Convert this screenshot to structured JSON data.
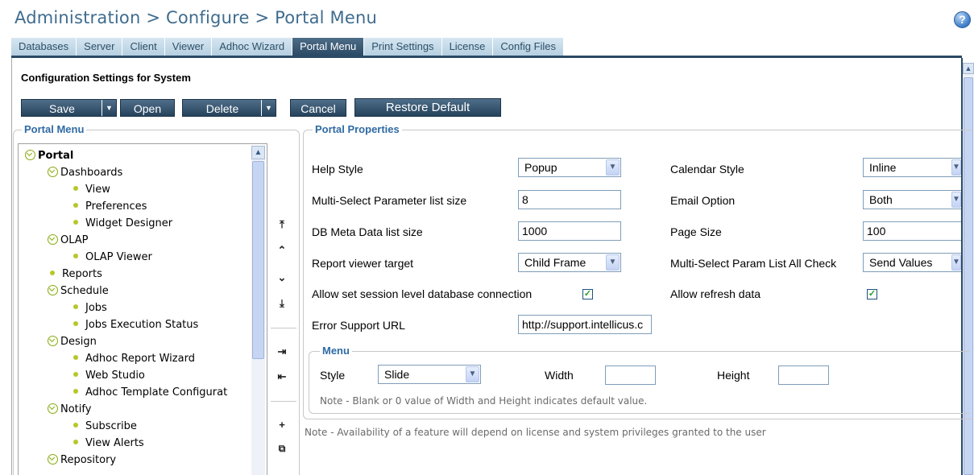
{
  "header": {
    "title": "Administration > Configure > Portal Menu",
    "help": "?"
  },
  "tabs": [
    {
      "label": "Databases"
    },
    {
      "label": "Server"
    },
    {
      "label": "Client"
    },
    {
      "label": "Viewer"
    },
    {
      "label": "Adhoc Wizard"
    },
    {
      "label": "Portal Menu",
      "active": true
    },
    {
      "label": "Print Settings"
    },
    {
      "label": "License"
    },
    {
      "label": "Config Files"
    }
  ],
  "config_heading": "Configuration Settings for System",
  "toolbar": {
    "save": "Save",
    "open": "Open",
    "delete": "Delete",
    "cancel": "Cancel",
    "restore": "Restore Default"
  },
  "portal_menu": {
    "legend": "Portal Menu",
    "items": [
      {
        "label": "Portal",
        "level": 0,
        "kind": "folder"
      },
      {
        "label": "Dashboards",
        "level": 1,
        "kind": "folder"
      },
      {
        "label": "View",
        "level": 2,
        "kind": "leaf"
      },
      {
        "label": "Preferences",
        "level": 2,
        "kind": "leaf"
      },
      {
        "label": "Widget Designer",
        "level": 2,
        "kind": "leaf"
      },
      {
        "label": "OLAP",
        "level": 1,
        "kind": "folder"
      },
      {
        "label": "OLAP Viewer",
        "level": 2,
        "kind": "leaf"
      },
      {
        "label": "Reports",
        "level": 1,
        "kind": "leaf"
      },
      {
        "label": "Schedule",
        "level": 1,
        "kind": "folder"
      },
      {
        "label": "Jobs",
        "level": 2,
        "kind": "leaf"
      },
      {
        "label": "Jobs Execution Status",
        "level": 2,
        "kind": "leaf"
      },
      {
        "label": "Design",
        "level": 1,
        "kind": "folder"
      },
      {
        "label": "Adhoc Report Wizard",
        "level": 2,
        "kind": "leaf"
      },
      {
        "label": "Web Studio",
        "level": 2,
        "kind": "leaf"
      },
      {
        "label": "Adhoc Template Configurat",
        "level": 2,
        "kind": "leaf"
      },
      {
        "label": "Notify",
        "level": 1,
        "kind": "folder"
      },
      {
        "label": "Subscribe",
        "level": 2,
        "kind": "leaf"
      },
      {
        "label": "View Alerts",
        "level": 2,
        "kind": "leaf"
      },
      {
        "label": "Repository",
        "level": 1,
        "kind": "folder"
      }
    ]
  },
  "move_buttons": {
    "top": "⤒",
    "up": "⌃",
    "down": "⌄",
    "bottom": "⤓",
    "indent": "⇥",
    "outdent": "⇤",
    "add": "+",
    "copy": "⧉"
  },
  "properties": {
    "legend": "Portal Properties",
    "help_style_label": "Help Style",
    "help_style_value": "Popup",
    "multi_select_label": "Multi-Select Parameter list size",
    "multi_select_value": "8",
    "db_meta_label": "DB Meta Data list size",
    "db_meta_value": "1000",
    "viewer_target_label": "Report viewer target",
    "viewer_target_value": "Child Frame",
    "session_db_label": "Allow set session level database connection",
    "session_db_checked": "✓",
    "error_url_label": "Error Support URL",
    "error_url_value": "http://support.intellicus.c",
    "calendar_label": "Calendar Style",
    "calendar_value": "Inline",
    "email_label": "Email Option",
    "email_value": "Both",
    "page_size_label": "Page Size",
    "page_size_value": "100",
    "all_check_label": "Multi-Select Param List All Check",
    "all_check_value": "Send Values",
    "refresh_label": "Allow refresh data",
    "refresh_checked": "✓"
  },
  "menu": {
    "legend": "Menu",
    "style_label": "Style",
    "style_value": "Slide",
    "width_label": "Width",
    "width_value": "",
    "height_label": "Height",
    "height_value": "",
    "note": "Note - Blank or 0 value of Width and Height indicates default value."
  },
  "footer_note": "Note - Availability of a feature will depend on license and system privileges granted to the user",
  "colors": {
    "title": "#3f6c8e",
    "tab_active": "#2b4a65",
    "legend": "#2f6aa3",
    "button": "#26435c",
    "tree_icon": "#8aa81c"
  }
}
